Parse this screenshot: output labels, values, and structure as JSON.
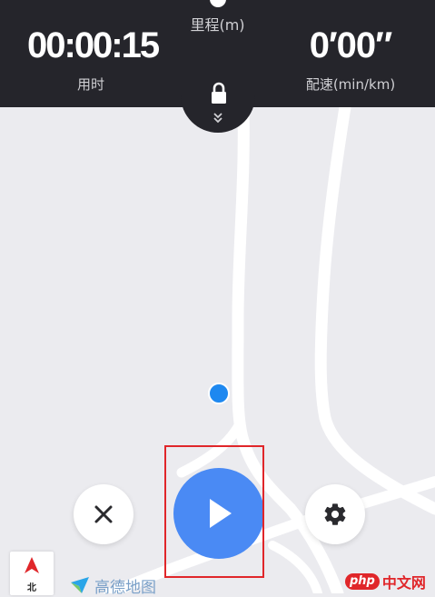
{
  "stats": {
    "distance_label": "里程(m)",
    "time_value": "00:00:15",
    "time_label": "用时",
    "pace_value": "0′00″",
    "pace_label": "配速(min/km)"
  },
  "icons": {
    "lock": "lock-icon",
    "expand": "chevron-double-down-icon",
    "stop": "close-icon",
    "play": "play-icon",
    "settings": "gear-icon",
    "compass": "north-arrow-icon"
  },
  "compass": {
    "label": "北"
  },
  "map_logo": {
    "name": "高德地图"
  },
  "watermark": {
    "brand": "php",
    "suffix": "中文网"
  },
  "colors": {
    "header_bg": "#25252b",
    "play_button": "#4a8af4",
    "location_dot": "#1e88f0",
    "highlight": "#e0262a"
  }
}
